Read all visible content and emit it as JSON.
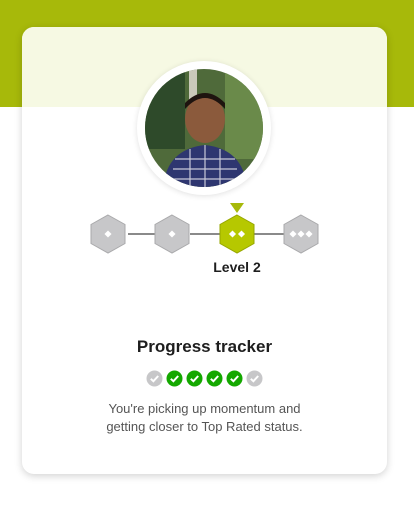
{
  "card": {
    "level_label": "Level 2",
    "title": "Progress tracker",
    "description_line1": "You're picking up momentum and",
    "description_line2": "getting closer to Top Rated status."
  },
  "levels": {
    "current": 2,
    "total": 4
  },
  "progress_checks": {
    "completed": 4,
    "total": 6
  },
  "colors": {
    "brand_green": "#a7b90a",
    "check_green": "#14a800",
    "inactive_gray": "#c7c7c9"
  },
  "icons": {
    "avatar": "profile-photo",
    "checks": "check-circle-icon"
  }
}
